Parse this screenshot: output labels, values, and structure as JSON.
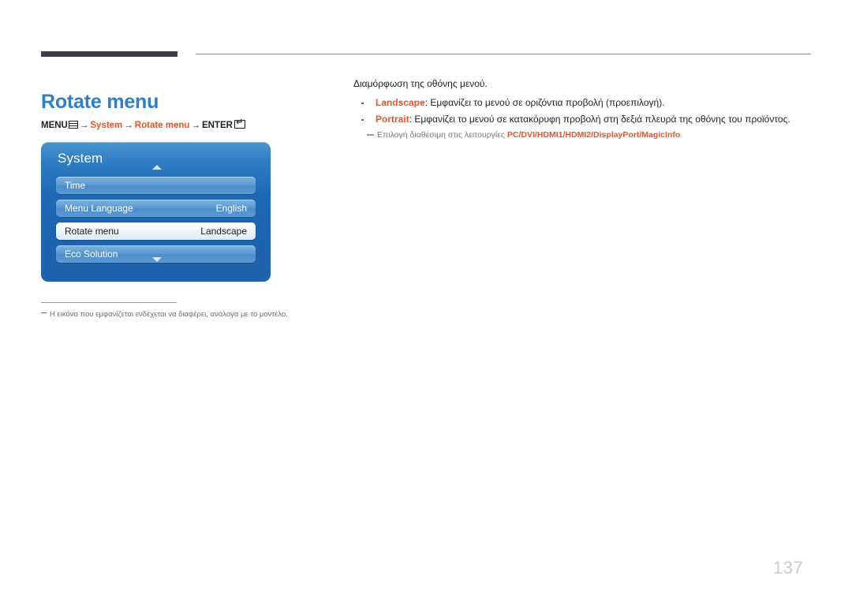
{
  "page": {
    "title": "Rotate menu",
    "number": "137"
  },
  "breadcrumb": {
    "menu_label": "MENU",
    "menu_icon": "menu-bars-icon",
    "arrow": "→",
    "step1": "System",
    "step2": "Rotate menu",
    "enter_label": "ENTER",
    "enter_icon": "enter-arrow-icon"
  },
  "osd": {
    "header": "System",
    "scroll_up_icon": "chevron-up-icon",
    "scroll_down_icon": "chevron-down-icon",
    "rows": [
      {
        "label": "Time",
        "value": "",
        "selected": false
      },
      {
        "label": "Menu Language",
        "value": "English",
        "selected": false
      },
      {
        "label": "Rotate menu",
        "value": "Landscape",
        "selected": true
      },
      {
        "label": "Eco Solution",
        "value": "",
        "selected": false
      }
    ]
  },
  "image_note": "Η εικόνα που εμφανίζεται ενδέχεται να διαφέρει, ανάλογα με το μοντέλο.",
  "description": {
    "intro": "Διαμόρφωση της οθόνης μενού.",
    "bullets": [
      {
        "term": "Landscape",
        "text": ": Εμφανίζει το μενού σε οριζόντια προβολή (προεπιλογή)."
      },
      {
        "term": "Portrait",
        "text": ": Εμφανίζει το μενού σε κατακόρυφη προβολή στη δεξιά πλευρά της οθόνης του προϊόντος."
      }
    ],
    "sub_note_prefix": "Επιλογή διαθέσιμη στις λειτουργίες ",
    "sub_note_inputs": "PC/DVI/HDMI1/HDMI2/DisplayPort/MagicInfo",
    "sub_note_suffix": "."
  },
  "colors": {
    "title_blue": "#2f7fc4",
    "accent_orange": "#e4562c",
    "rule_dark": "#413c4b",
    "osd_blue": "#1f69b4",
    "page_number_gray": "#c9c9d4"
  }
}
